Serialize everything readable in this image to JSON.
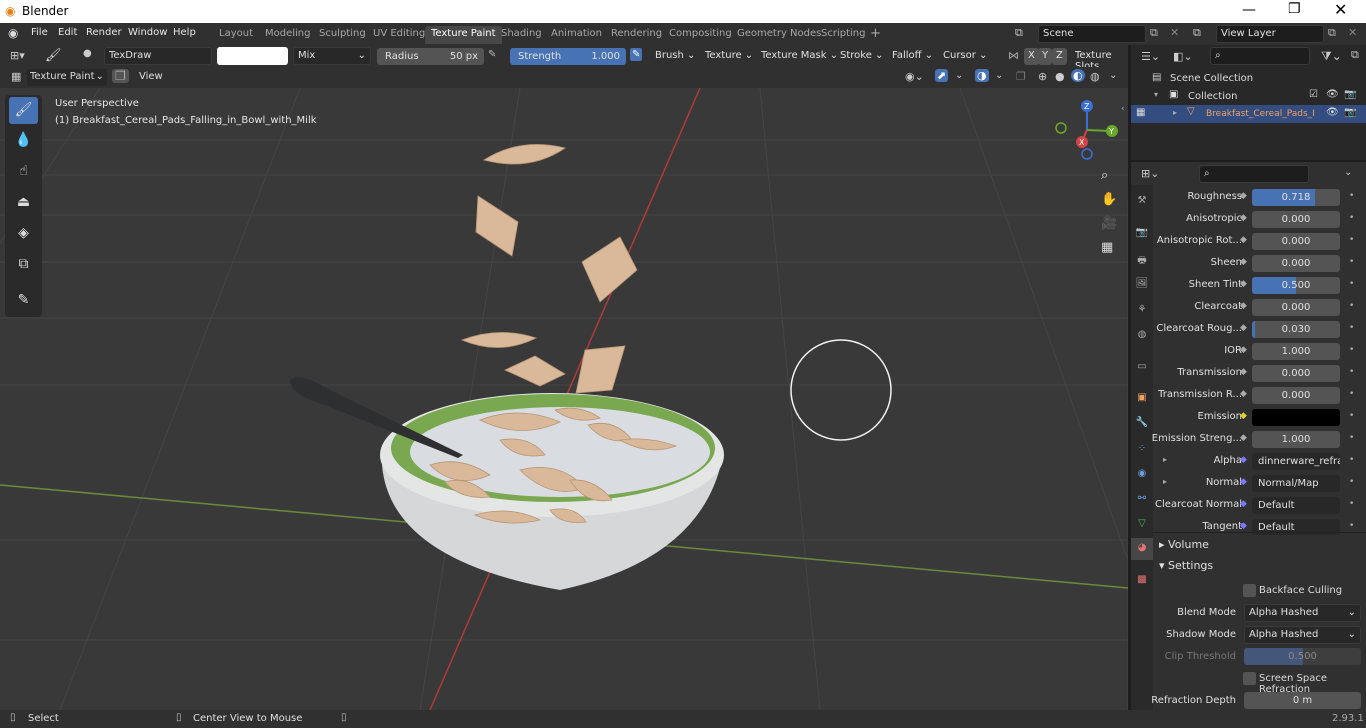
{
  "titlebar": {
    "title": "Blender"
  },
  "menus": [
    "File",
    "Edit",
    "Render",
    "Window",
    "Help"
  ],
  "workspaces": [
    "Layout",
    "Modeling",
    "Sculpting",
    "UV Editing",
    "Texture Paint",
    "Shading",
    "Animation",
    "Rendering",
    "Compositing",
    "Geometry Nodes",
    "Scripting"
  ],
  "active_workspace": "Texture Paint",
  "scene": "Scene",
  "view_layer": "View Layer",
  "tool": {
    "brush": "TexDraw",
    "blend": "Mix",
    "radius_label": "Radius",
    "radius_value": "50 px",
    "strength_label": "Strength",
    "strength_value": "1.000",
    "menus": [
      "Brush",
      "Texture",
      "Texture Mask",
      "Stroke",
      "Falloff",
      "Cursor"
    ],
    "texture_slots": "Texture Slots",
    "axes": [
      "X",
      "Y",
      "Z"
    ]
  },
  "mode": "Texture Paint",
  "view_menu": "View",
  "viewport": {
    "perspective": "User Perspective",
    "object_label": "(1) Breakfast_Cereal_Pads_Falling_in_Bowl_with_Milk",
    "gizmo": {
      "z": "Z",
      "y": "Y",
      "x": "X"
    }
  },
  "outliner": {
    "scene_collection": "Scene Collection",
    "collection": "Collection",
    "object": "Breakfast_Cereal_Pads_I"
  },
  "properties": [
    {
      "label": "Roughness",
      "value": "0.718",
      "fill": 0.718
    },
    {
      "label": "Anisotropic",
      "value": "0.000",
      "fill": 0
    },
    {
      "label": "Anisotropic Rot...",
      "value": "0.000",
      "fill": 0
    },
    {
      "label": "Sheen",
      "value": "0.000",
      "fill": 0
    },
    {
      "label": "Sheen Tint",
      "value": "0.500",
      "fill": 0.5
    },
    {
      "label": "Clearcoat",
      "value": "0.000",
      "fill": 0
    },
    {
      "label": "Clearcoat Roug...",
      "value": "0.030",
      "fill": 0.03
    },
    {
      "label": "IOR",
      "value": "1.000",
      "fill": 0
    },
    {
      "label": "Transmission",
      "value": "0.000",
      "fill": 0
    },
    {
      "label": "Transmission R...",
      "value": "0.000",
      "fill": 0
    },
    {
      "label": "Emission",
      "value": "",
      "fill": 0
    },
    {
      "label": "Emission Streng...",
      "value": "1.000",
      "fill": 0
    },
    {
      "label": "Alpha",
      "value": "dinnerware_refracti...",
      "fill": 0
    },
    {
      "label": "Normal",
      "value": "Normal/Map",
      "fill": 0
    },
    {
      "label": "Clearcoat Normal",
      "value": "Default",
      "fill": 0
    },
    {
      "label": "Tangent",
      "value": "Default",
      "fill": 0
    }
  ],
  "sections": {
    "volume": "Volume",
    "settings": "Settings"
  },
  "settings": {
    "backface": "Backface Culling",
    "blend_label": "Blend Mode",
    "blend_value": "Alpha Hashed",
    "shadow_label": "Shadow Mode",
    "shadow_value": "Alpha Hashed",
    "clip_label": "Clip Threshold",
    "clip_value": "0.500",
    "ssr": "Screen Space Refraction",
    "refraction_label": "Refraction Depth",
    "refraction_value": "0 m"
  },
  "status": {
    "select": "Select",
    "center": "Center View to Mouse",
    "version": "2.93.1"
  },
  "colors": {
    "accent": "#4772b3",
    "emission": "#000000"
  }
}
